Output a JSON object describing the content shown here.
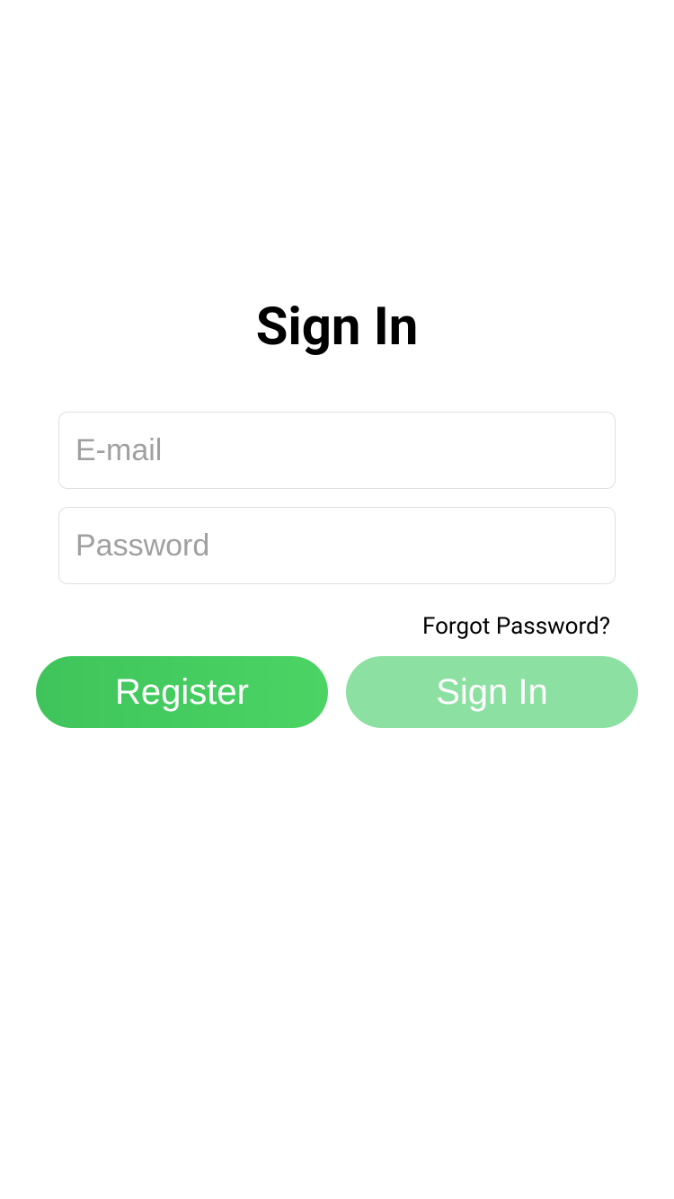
{
  "title": "Sign In",
  "form": {
    "email": {
      "placeholder": "E-mail",
      "value": ""
    },
    "password": {
      "placeholder": "Password",
      "value": ""
    }
  },
  "forgot_password_label": "Forgot Password?",
  "buttons": {
    "register_label": "Register",
    "signin_label": "Sign In"
  },
  "colors": {
    "primary_green": "#3fc45b",
    "primary_green_gradient_end": "#4bd464",
    "disabled_green": "#8ce1a2",
    "border": "#e0e0e0",
    "placeholder": "#a0a0a0"
  }
}
